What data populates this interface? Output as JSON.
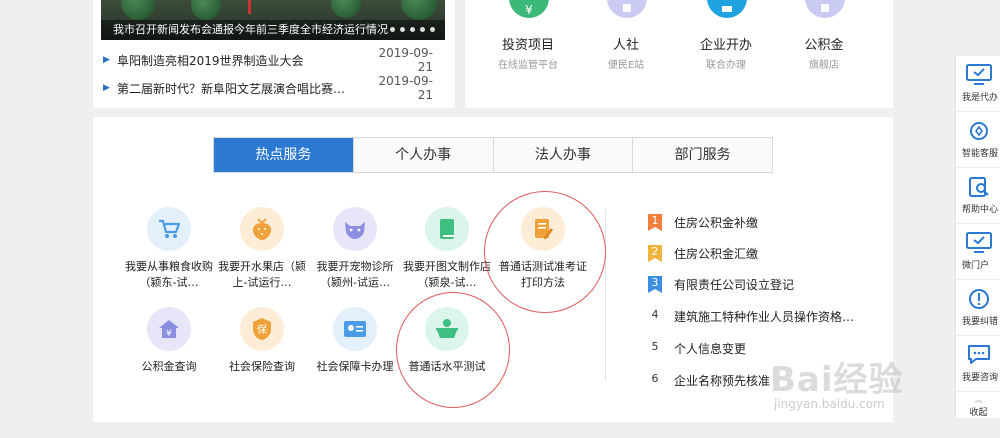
{
  "news": {
    "banner_caption": "我市召开新闻发布会通报今年前三季度全市经济运行情况",
    "items": [
      {
        "title": "阜阳制造亮相2019世界制造业大会",
        "date": "2019-09-21"
      },
      {
        "title": "第二届新时代？新阜阳文艺展演合唱比赛…",
        "date": "2019-09-21"
      }
    ]
  },
  "quick_services": [
    {
      "name": "投资项目",
      "sub": "在线监管平台",
      "color": "#3cb878",
      "icon": "money-bag-icon"
    },
    {
      "name": "人社",
      "sub": "便民E站",
      "color": "#c9cbf2",
      "icon": "person-icon"
    },
    {
      "name": "企业开办",
      "sub": "联合办理",
      "color": "#1fa3e0",
      "icon": "building-icon"
    },
    {
      "name": "公积金",
      "sub": "旗舰店",
      "color": "#c9cbf2",
      "icon": "fund-icon"
    }
  ],
  "tabs": [
    "热点服务",
    "个人办事",
    "法人办事",
    "部门服务"
  ],
  "services": [
    {
      "label": "我要从事粮食收购（颍东-试…",
      "icon": "cart-icon",
      "bg": "#e3effb",
      "fg": "#4a9be8"
    },
    {
      "label": "我要开水果店（颍上-试运行…",
      "icon": "strawberry-icon",
      "bg": "#fdecd6",
      "fg": "#f0a23a"
    },
    {
      "label": "我要开宠物诊所（颍州-试运…",
      "icon": "pet-icon",
      "bg": "#e6e6f8",
      "fg": "#8c8ee0"
    },
    {
      "label": "我要开图文制作店（颍泉-试…",
      "icon": "book-icon",
      "bg": "#dcf5ea",
      "fg": "#3cbf7f"
    },
    {
      "label": "普通话测试准考证打印方法",
      "icon": "document-icon",
      "bg": "#fdecd6",
      "fg": "#f0a23a"
    },
    {
      "label": "公积金查询",
      "icon": "house-yen-icon",
      "bg": "#e6e6f8",
      "fg": "#8c8ee0"
    },
    {
      "label": "社会保险查询",
      "icon": "shield-icon",
      "bg": "#fdecd6",
      "fg": "#f0a23a"
    },
    {
      "label": "社会保障卡办理",
      "icon": "id-card-icon",
      "bg": "#e3effb",
      "fg": "#4a9be8"
    },
    {
      "label": "普通话水平测试",
      "icon": "speaker-icon",
      "bg": "#dcf5ea",
      "fg": "#3cbf7f"
    }
  ],
  "ranking": [
    {
      "rank": "1",
      "text": "住房公积金补缴",
      "color": "#f07f3c"
    },
    {
      "rank": "2",
      "text": "住房公积金汇缴",
      "color": "#f0b43c"
    },
    {
      "rank": "3",
      "text": "有限责任公司设立登记",
      "color": "#3c8ee0"
    },
    {
      "rank": "4",
      "text": "建筑施工特种作业人员操作资格…",
      "color": ""
    },
    {
      "rank": "5",
      "text": "个人信息变更",
      "color": ""
    },
    {
      "rank": "6",
      "text": "企业名称预先核准",
      "color": ""
    }
  ],
  "sidebar": {
    "items": [
      {
        "label": "我是代办",
        "icon": "monitor-check-icon"
      },
      {
        "label": "智能客服",
        "icon": "robot-icon"
      },
      {
        "label": "帮助中心",
        "icon": "help-doc-icon"
      },
      {
        "label": "微门户",
        "icon": "monitor-icon"
      },
      {
        "label": "我要纠错",
        "icon": "warning-icon"
      },
      {
        "label": "我要咨询",
        "icon": "chat-icon"
      }
    ],
    "collapse": "收起"
  },
  "watermark": {
    "brand": "Bai经验",
    "url": "jingyan.baidu.com"
  }
}
